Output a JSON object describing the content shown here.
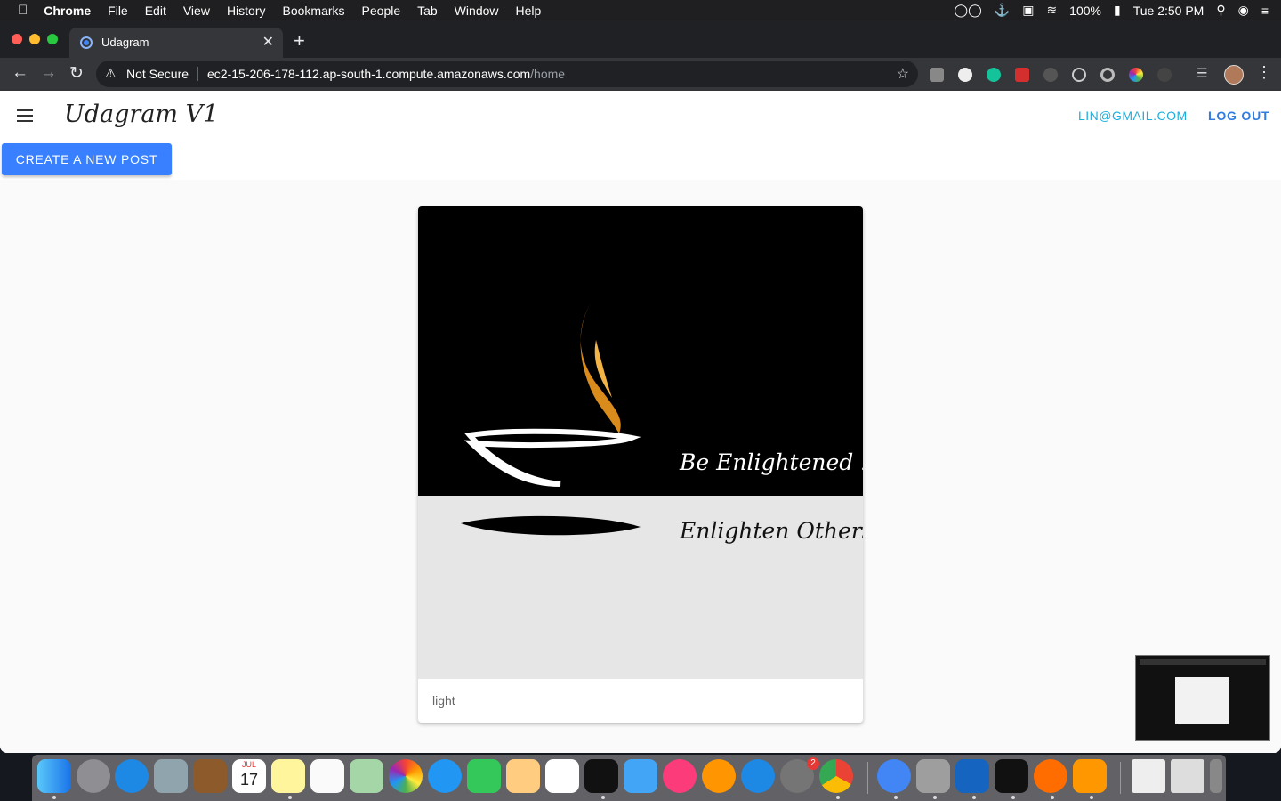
{
  "menubar": {
    "app_name": "Chrome",
    "menus": [
      "File",
      "Edit",
      "View",
      "History",
      "Bookmarks",
      "People",
      "Tab",
      "Window",
      "Help"
    ],
    "battery": "100%",
    "clock": "Tue 2:50 PM"
  },
  "browser": {
    "tab_title": "Udagram",
    "security_label": "Not Secure",
    "url_host": "ec2-15-206-178-112.ap-south-1.compute.amazonaws.com",
    "url_path": "/home"
  },
  "app": {
    "brand": "Udagram V1",
    "user_email": "LIN@GMAIL.COM",
    "logout_label": "LOG OUT",
    "create_post_label": "CREATE A NEW POST"
  },
  "feed": {
    "posts": [
      {
        "image_text_line1": "Be Enlightened !",
        "image_text_line2": "Enlighten Others !",
        "caption": "light"
      }
    ]
  },
  "dock": {
    "calendar_month": "JUL",
    "calendar_day": "17",
    "system_prefs_badge": "2"
  },
  "colors": {
    "primary_button": "#3880ff",
    "email_link": "#1eaedb",
    "logout_link": "#2f7de1"
  }
}
